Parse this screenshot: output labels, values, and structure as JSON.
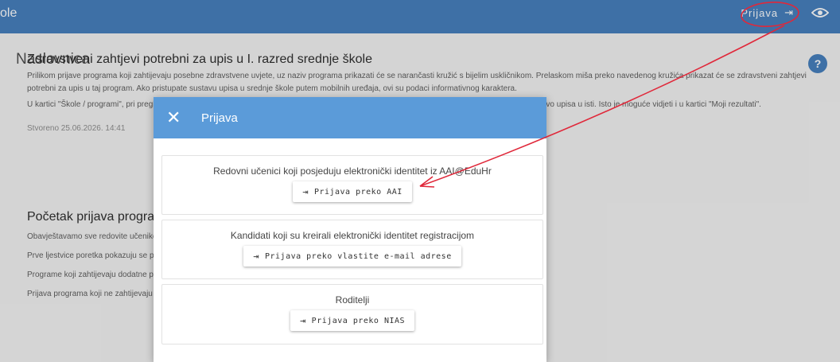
{
  "topbar": {
    "brand": "ole",
    "login_label": "Prijava",
    "login_icon": "login-icon",
    "eye_icon": "eye-icon",
    "accent": "#3b78ba"
  },
  "page": {
    "title": "Naslovnica",
    "help_label": "?",
    "section1": {
      "heading": "Zdravstveni zahtjevi potrebni za upis u I. razred srednje škole",
      "p1": "Prilikom prijave programa koji zahtijevaju posebne zdravstvene uvjete, uz naziv programa prikazati će se narančasti kružić s bijelim uskličnikom. Prelaskom miša preko navedenog kružića prikazat će se zdravstveni zahtjevi potrebni za upis u taj program. Ako pristupate sustavu upisa u srednje škole putem mobilnih uređaja, ovi su podaci informativnog karaktera.",
      "p2": "U kartici \"Škole / programi\", pri pregledu programa moguće je vidjeti zdravstvene zahtjeve koje je potrebno zadovoljavati kako bi učenik ostvario pravo upisa u isti. Isto je moguće vidjeti i u kartici \"Moji rezultati\".",
      "timestamp": "Stvoreno 25.06.2026. 14:41"
    },
    "section2": {
      "heading": "Početak prijava programa",
      "p1": "Obavještavamo sve redovite učenike da su prijave programa otvorene te mogu izvršiti svoj odabir.",
      "p2": "Prve ljestvice poretka pokazuju se po završetku",
      "p3": "Programe koji zahtijevaju dodatne provjere",
      "p4": "Prijava programa koji ne zahtijevaju"
    }
  },
  "modal": {
    "title": "Prijava",
    "close_icon": "close-icon",
    "header_color": "#5b9bd9",
    "options": [
      {
        "label": "Redovni učenici koji posjeduju elektronički identitet iz AAI@EduHr",
        "button": "Prijava preko AAI"
      },
      {
        "label": "Kandidati koji su kreirali elektronički identitet registracijom",
        "button": "Prijava preko vlastite e-mail adrese"
      },
      {
        "label": "Roditelji",
        "button": "Prijava preko NIAS"
      }
    ]
  },
  "annotation": {
    "color": "#e0283a"
  }
}
